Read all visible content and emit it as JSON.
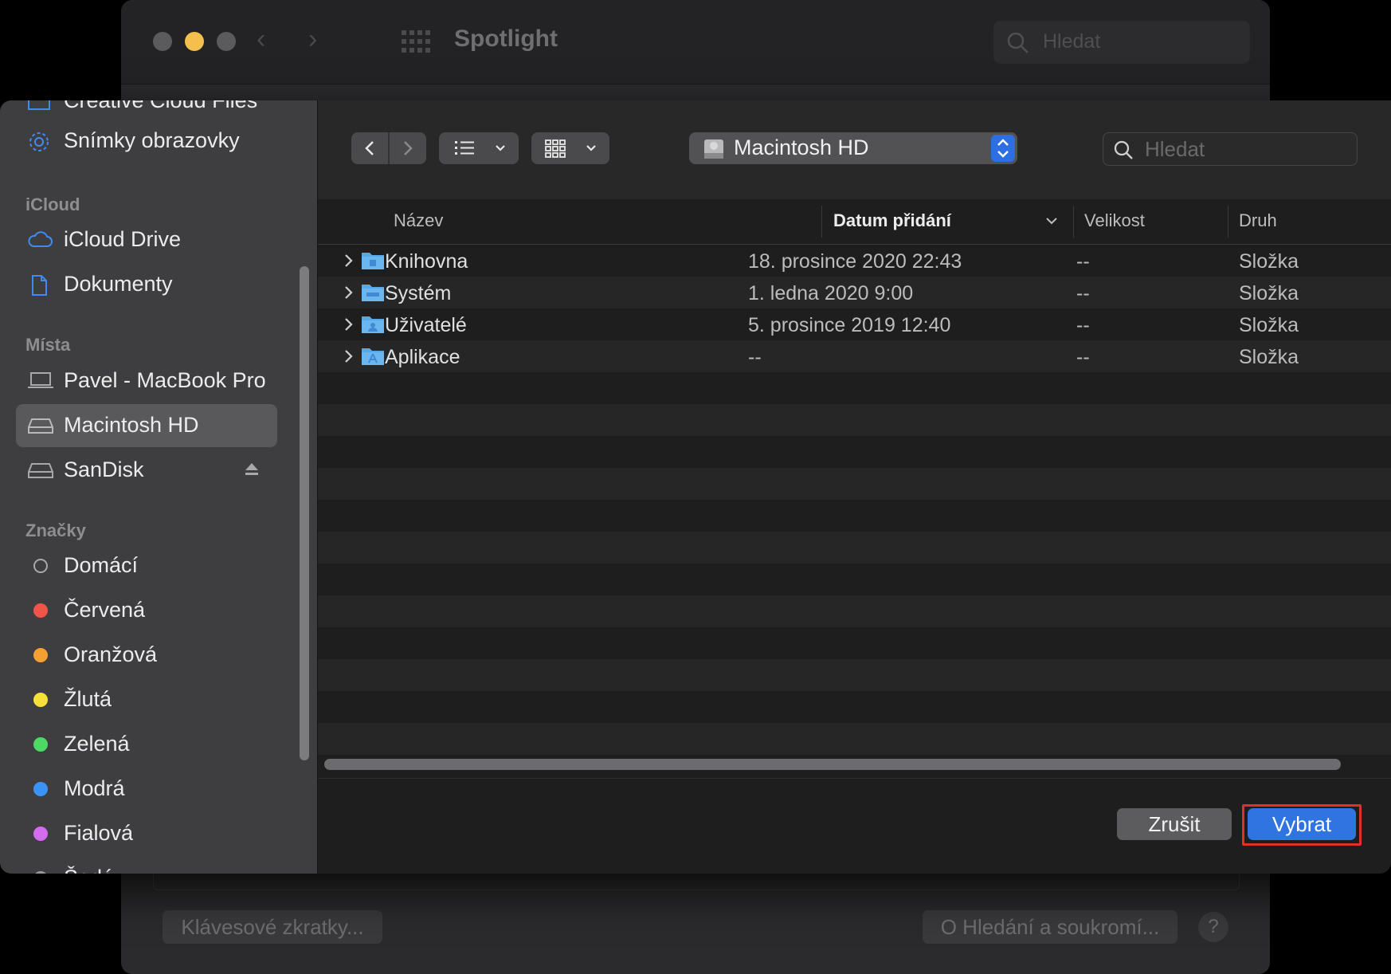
{
  "background_window": {
    "title": "Spotlight",
    "search_placeholder": "Hledat",
    "shortcuts_button": "Klávesové zkratky...",
    "privacy_button": "O Hledání a soukromí...",
    "help_button": "?"
  },
  "sidebar": {
    "partial_top_item": "Creative Cloud Files",
    "items_top": [
      {
        "label": "Snímky obrazovky",
        "icon": "gear-icon"
      }
    ],
    "icloud_heading": "iCloud",
    "icloud_items": [
      {
        "label": "iCloud Drive",
        "icon": "cloud-icon"
      },
      {
        "label": "Dokumenty",
        "icon": "document-icon"
      }
    ],
    "places_heading": "Místa",
    "places_items": [
      {
        "label": "Pavel - MacBook Pro",
        "icon": "laptop-icon"
      },
      {
        "label": "Macintosh HD",
        "icon": "disk-icon",
        "selected": true
      },
      {
        "label": "SanDisk",
        "icon": "disk-icon"
      }
    ],
    "tags_heading": "Značky",
    "tags": [
      {
        "label": "Domácí",
        "color": "none"
      },
      {
        "label": "Červená",
        "color": "#f0554a"
      },
      {
        "label": "Oranžová",
        "color": "#f5a033"
      },
      {
        "label": "Žlutá",
        "color": "#f7e03a"
      },
      {
        "label": "Zelená",
        "color": "#4cd964"
      },
      {
        "label": "Modrá",
        "color": "#3b94f5"
      },
      {
        "label": "Fialová",
        "color": "#d46cf0"
      }
    ],
    "partial_bottom_item": "Šedá"
  },
  "toolbar": {
    "location": "Macintosh HD",
    "search_placeholder": "Hledat"
  },
  "columns": {
    "name": "Název",
    "date_added": "Datum přidání",
    "size": "Velikost",
    "kind": "Druh"
  },
  "files": [
    {
      "name": "Knihovna",
      "date": "18. prosince 2020 22:43",
      "size": "--",
      "kind": "Složka"
    },
    {
      "name": "Systém",
      "date": "1. ledna 2020 9:00",
      "size": "--",
      "kind": "Složka"
    },
    {
      "name": "Uživatelé",
      "date": "5. prosince 2019 12:40",
      "size": "--",
      "kind": "Složka"
    },
    {
      "name": "Aplikace",
      "date": "--",
      "size": "--",
      "kind": "Složka"
    }
  ],
  "buttons": {
    "cancel": "Zrušit",
    "choose": "Vybrat"
  },
  "colors": {
    "accent": "#2f74e0",
    "highlight_border": "#e0302b"
  }
}
